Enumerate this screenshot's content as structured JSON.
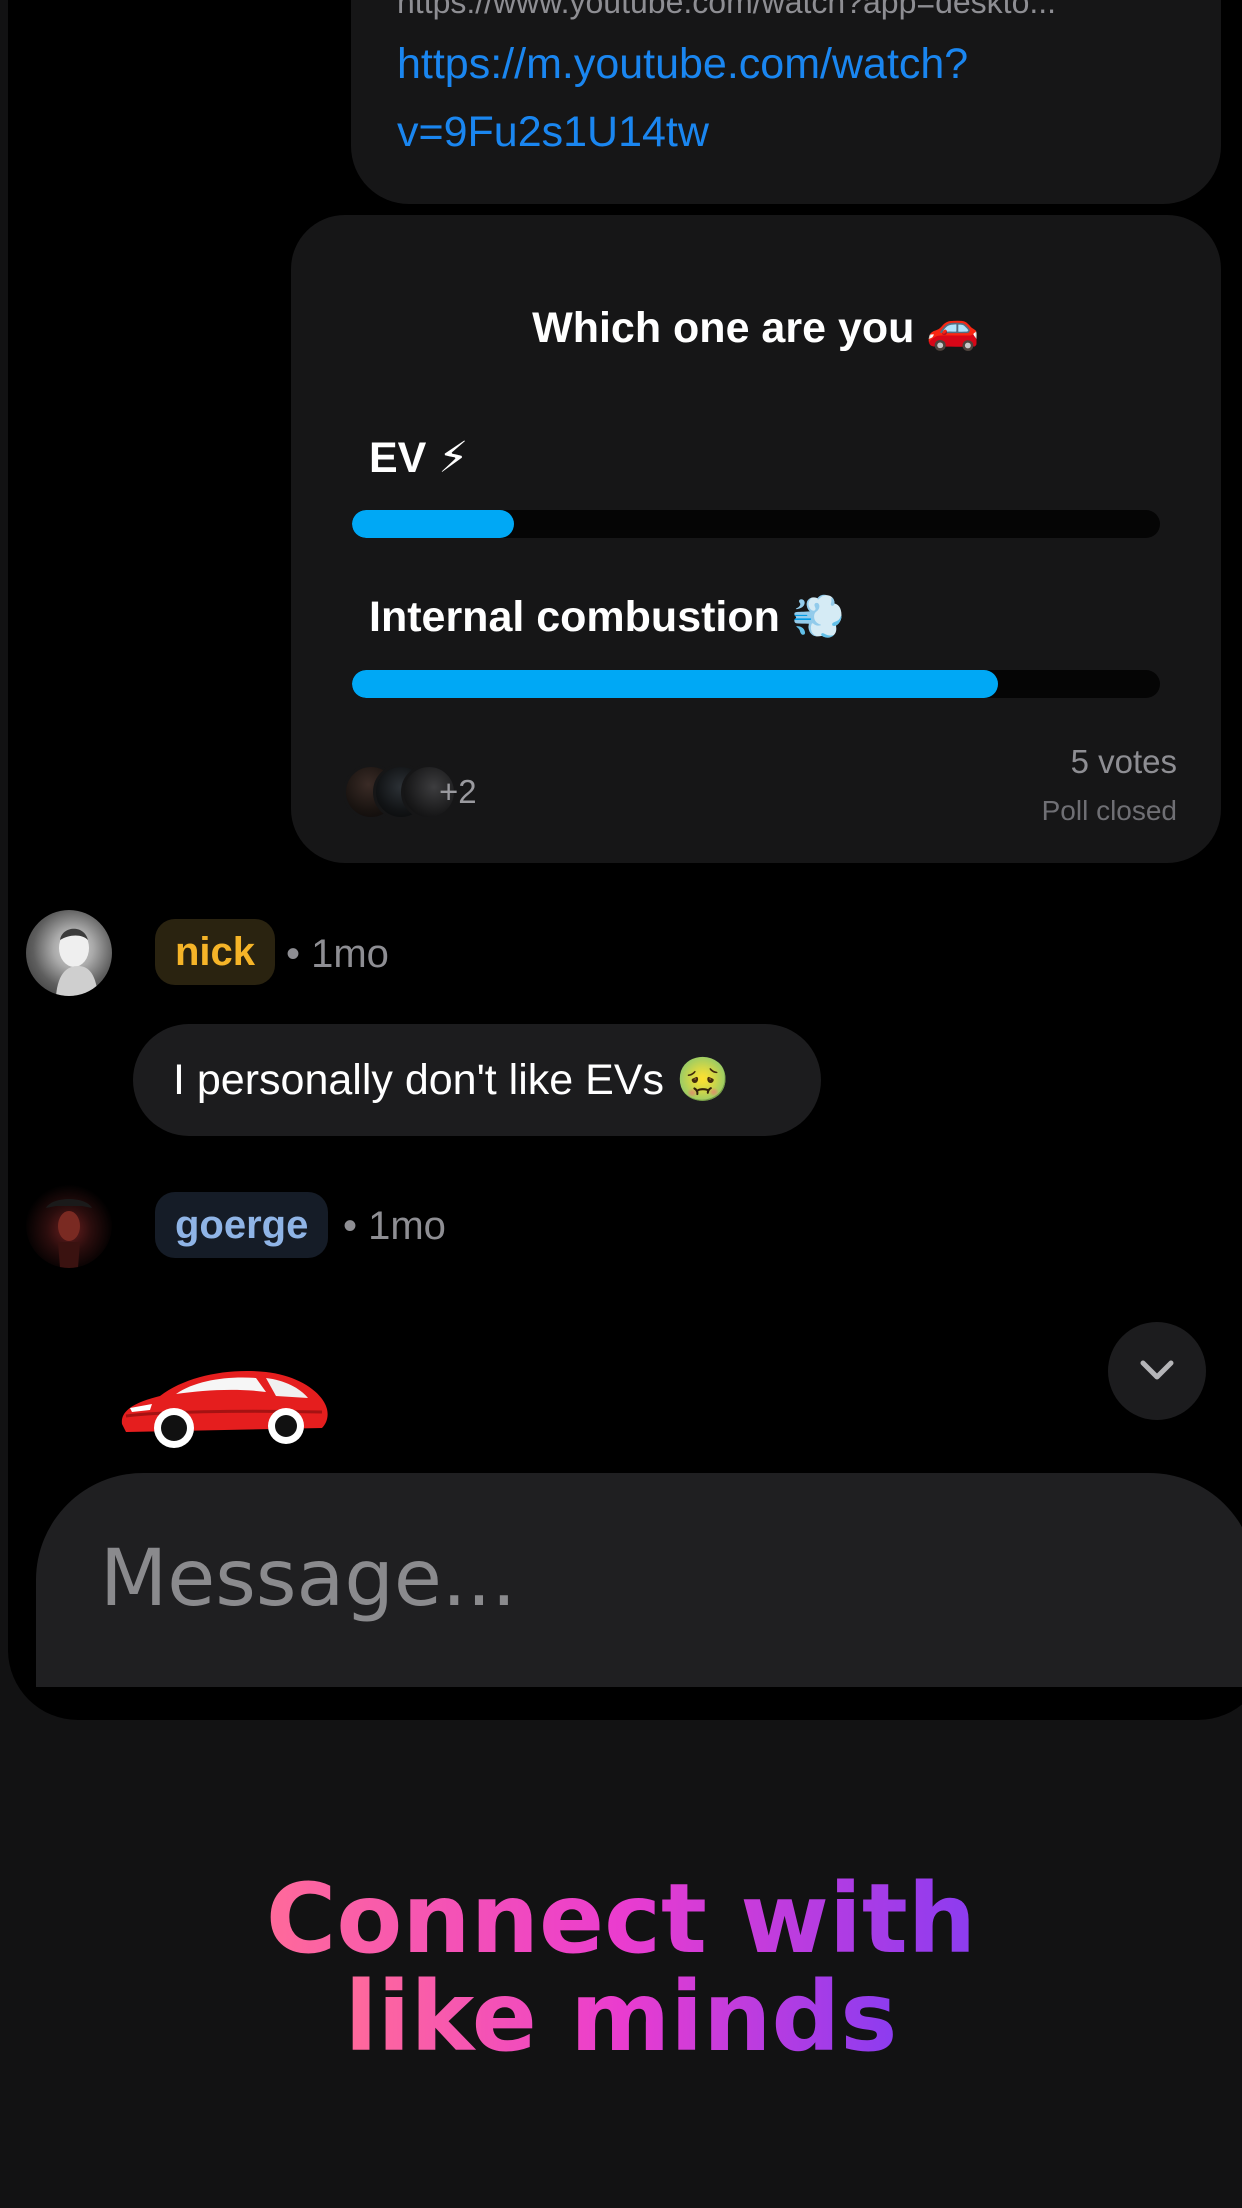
{
  "link_card": {
    "cut_url": "https://www.youtube.com/watch?app=deskto...",
    "link": "https://m.youtube.com/watch?v=9Fu2s1U14tw"
  },
  "poll": {
    "title": "Which one are you 🚗",
    "options": [
      {
        "label": "EV ⚡",
        "fraction": 0.2
      },
      {
        "label": "Internal combustion 💨",
        "fraction": 0.8
      }
    ],
    "voters_more": "+2",
    "votes": "5 votes",
    "status": "Poll closed",
    "bar_color": "#00a8f5"
  },
  "messages": [
    {
      "author": "nick",
      "time": "• 1mo",
      "text": "I personally don't like EVs 🤢",
      "author_color": "#f5b428"
    },
    {
      "author": "goerge",
      "time": "• 1mo",
      "sticker": "red-car-sticker",
      "author_color": "#8fb4e6"
    }
  ],
  "composer": {
    "placeholder": "Message..."
  },
  "scroll_button": {
    "icon": "chevron-down-icon"
  },
  "tagline": {
    "line1": "Connect with",
    "line2": "like minds"
  }
}
